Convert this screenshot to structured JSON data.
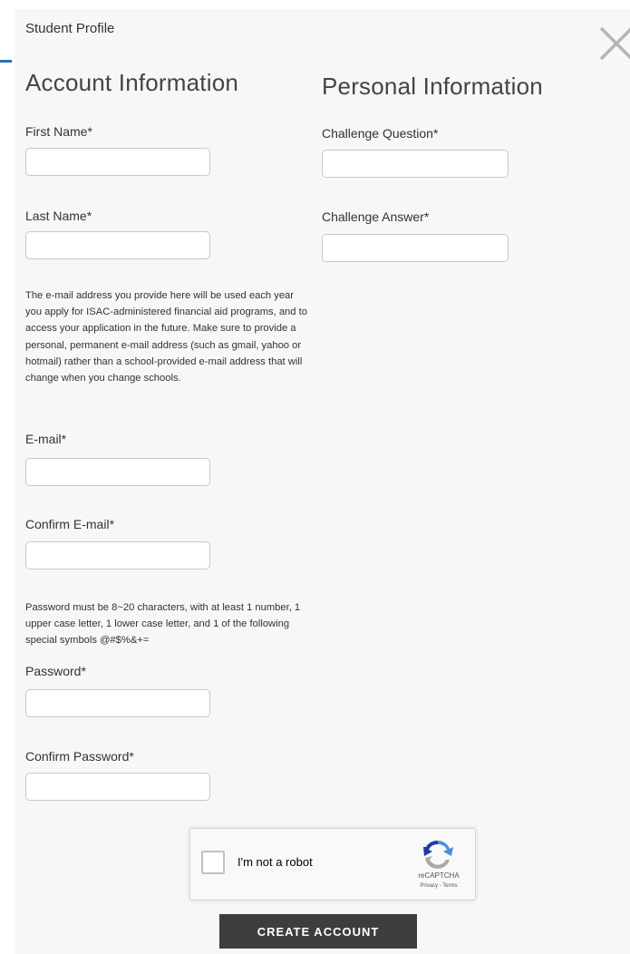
{
  "modal": {
    "title": "Student Profile"
  },
  "account": {
    "heading": "Account Information",
    "first_name_label": "First Name*",
    "last_name_label": "Last Name*",
    "email_help": "The e-mail address you provide here will be used each year you apply for ISAC-administered financial aid programs, and to access your application in the future. Make sure to provide a personal, permanent e-mail address (such as gmail, yahoo or hotmail) rather than a school-provided e-mail address that will change when you change schools.",
    "email_label": "E-mail*",
    "confirm_email_label": "Confirm E-mail*",
    "password_help": "Password must be 8~20 characters, with at least 1 number, 1 upper case letter, 1 lower case letter, and 1 of the following special symbols @#$%&+=",
    "password_label": "Password*",
    "confirm_password_label": "Confirm Password*"
  },
  "personal": {
    "heading": "Personal Information",
    "challenge_question_label": "Challenge Question*",
    "challenge_answer_label": "Challenge Answer*"
  },
  "recaptcha": {
    "label": "I'm not a robot",
    "brand": "reCAPTCHA",
    "links": "Privacy - Terms"
  },
  "actions": {
    "create_account_label": "CREATE ACCOUNT"
  },
  "colors": {
    "accent": "#2a6fb0",
    "button_bg": "#3d3d3d",
    "modal_bg": "#f7f7f7"
  },
  "icons": {
    "close": "close-icon",
    "recaptcha": "recaptcha-logo-icon"
  }
}
